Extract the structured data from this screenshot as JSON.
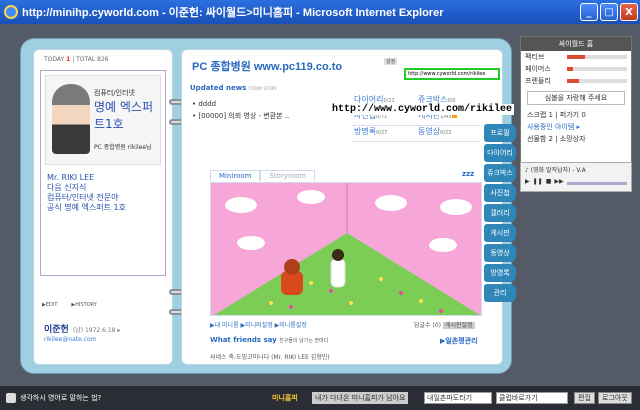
{
  "window": {
    "title": "http://minihp.cyworld.com - 이준헌: 싸이월드>미니홈피 - Microsoft Internet Explorer",
    "min": "_",
    "max": "□",
    "close": "X"
  },
  "left": {
    "today_label": "TODAY",
    "today_count": "1",
    "total_label": "TOTAL",
    "total_count": "826",
    "logo_top": "컴퓨터/인터넷",
    "logo_main": "명예 엑스퍼트1호",
    "brand_line": "PC 종합병원 rikilee님",
    "profile_lines": [
      "Mr. RIKI LEE",
      "다음 신지식",
      "컴퓨터/인터넷 전문야",
      "공식 명예 엑스퍼트 1호"
    ],
    "edit": "▶EDIT",
    "history": "▶HISTORY",
    "owner": "이준헌",
    "owner_meta": "(남) 1972.6.18 ▸",
    "email": "rikilee@nate.com"
  },
  "right": {
    "title": "PC 종합병원 www.pc119.co.to",
    "setting": "설정",
    "url": "http://www.cyworld.com/rikilee",
    "updated": "Updated news",
    "updated_sub": "TODAY STORY",
    "news": [
      "• dddd",
      "• [00000] 의뢰 영상 - 변환본 .."
    ],
    "stats": [
      {
        "label": "다이어리",
        "count": "0/21",
        "new": false
      },
      {
        "label": "쥬크박스",
        "count": "0/0",
        "new": false
      },
      {
        "label": "사진첩",
        "count": "0/71",
        "new": false
      },
      {
        "label": "게시판",
        "count": "1/43",
        "new": true
      },
      {
        "label": "방명록",
        "count": "0/27",
        "new": false
      },
      {
        "label": "동영상",
        "count": "0/23",
        "new": false
      }
    ],
    "tab_miniroom": "Miniroom",
    "tab_storyroom": "Storyroom",
    "zzz": "zzz",
    "mr_links": "▶내 미니룸 ▶미니미설정 ▶미니룸설정",
    "reply_label": "답글수",
    "reply_count": "(0)",
    "reply_btn": "게시판설정",
    "wfs": "What friends say",
    "wfs_sub": "친구들이 남기는 한마디",
    "wfs_link": "▶일촌평관리",
    "cut_line": "씨네스 축-도밍고미나다 (Mr. RIKI LEE 김형민)"
  },
  "nav": [
    "프로필",
    "다이어리",
    "쥬크박스",
    "사진첩",
    "갤러리",
    "게시판",
    "동영상",
    "방명록",
    "관리"
  ],
  "panel": {
    "head": "싸이월드 홈",
    "meters": [
      {
        "label": "팩티브",
        "value": 0.3
      },
      {
        "label": "페이머스",
        "value": 0.1
      },
      {
        "label": "프렌들리",
        "value": 0.2
      }
    ],
    "apply_btn": "심볼을 자랑해 주세요",
    "scrap_line": "스크랩 1 | 퍼가기 0",
    "friends_line": "사용중인 아이템 ▸",
    "gift_line": "선물함 2 | 소망상자",
    "player_song": "♪ (영화 말직남자) - V.A"
  },
  "overlay_url": "http://www.cyworld.com/rikilee",
  "status": {
    "question": "생각하시 영어로 말하는 법?",
    "minihp": "미니홈피",
    "visit": "내가 다녀온 미니홈피가 남아요",
    "sel1": "내일촌파도타기",
    "sel2": "클럽바로가기",
    "btn1": "편집",
    "btn2": "로그아웃"
  },
  "colors": {
    "accent": "#2a6ac0",
    "nav": "#2f86b8",
    "highlight": "#22cc22"
  }
}
